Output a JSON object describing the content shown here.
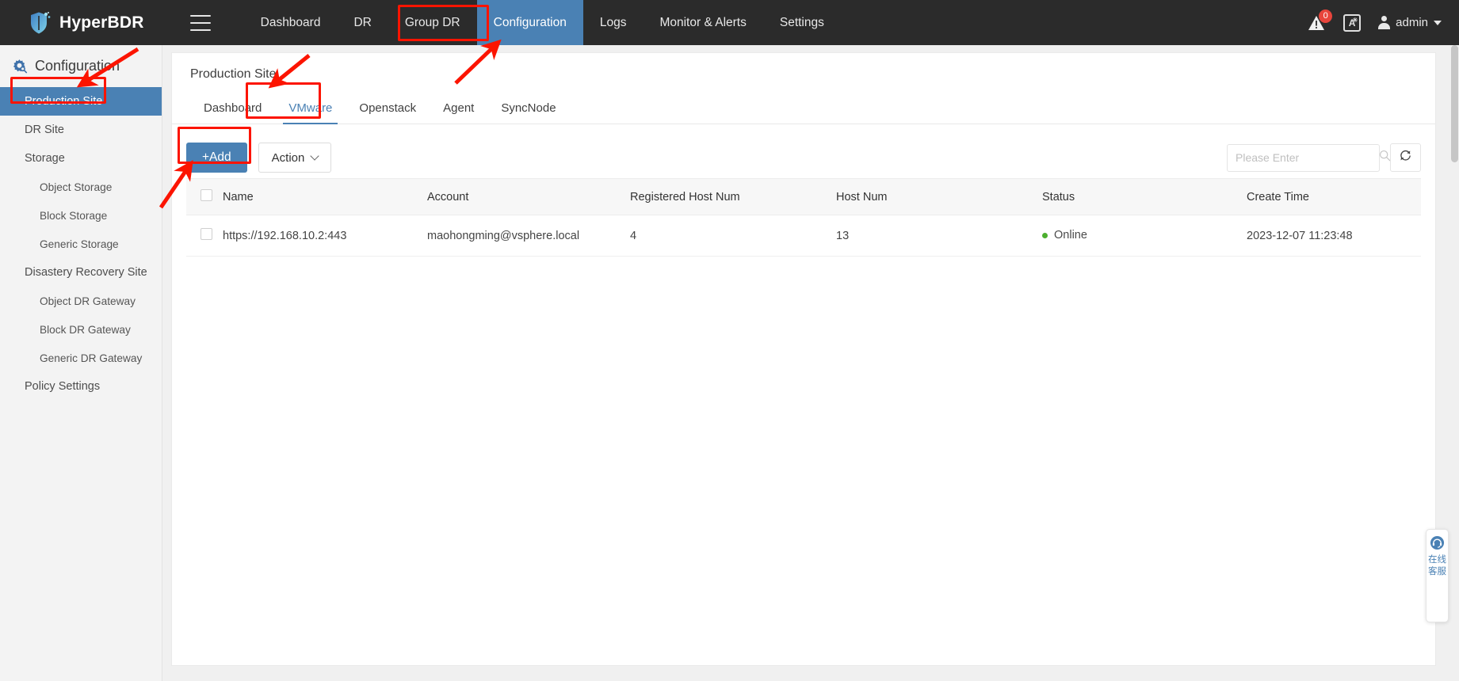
{
  "header": {
    "brand": "HyperBDR",
    "logo_icon": "shield-icon",
    "menu_icon": "hamburger-icon",
    "nav": [
      {
        "label": "Dashboard",
        "active": false
      },
      {
        "label": "DR",
        "active": false
      },
      {
        "label": "Group DR",
        "active": false
      },
      {
        "label": "Configuration",
        "active": true
      },
      {
        "label": "Logs",
        "active": false
      },
      {
        "label": "Monitor & Alerts",
        "active": false
      },
      {
        "label": "Settings",
        "active": false
      }
    ],
    "alert_icon": "warning-triangle-icon",
    "alert_count": "0",
    "language_icon": "translate-icon",
    "language_label": "A",
    "user_icon": "user-avatar-icon",
    "user_name": "admin",
    "user_caret_icon": "chevron-down-icon"
  },
  "sidebar": {
    "title": "Configuration",
    "title_icon": "gear-icon",
    "items": [
      {
        "label": "Production Site",
        "level": 1,
        "active": true
      },
      {
        "label": "DR Site",
        "level": 1,
        "active": false
      },
      {
        "label": "Storage",
        "level": 1,
        "active": false
      },
      {
        "label": "Object Storage",
        "level": 2,
        "active": false
      },
      {
        "label": "Block Storage",
        "level": 2,
        "active": false
      },
      {
        "label": "Generic Storage",
        "level": 2,
        "active": false
      },
      {
        "label": "Disastery Recovery Site",
        "level": 1,
        "active": false
      },
      {
        "label": "Object DR Gateway",
        "level": 2,
        "active": false
      },
      {
        "label": "Block DR Gateway",
        "level": 2,
        "active": false
      },
      {
        "label": "Generic DR Gateway",
        "level": 2,
        "active": false
      },
      {
        "label": "Policy Settings",
        "level": 1,
        "active": false
      }
    ]
  },
  "main": {
    "breadcrumb": "Production Site",
    "tabs": [
      {
        "label": "Dashboard",
        "active": false
      },
      {
        "label": "VMware",
        "active": true
      },
      {
        "label": "Openstack",
        "active": false
      },
      {
        "label": "Agent",
        "active": false
      },
      {
        "label": "SyncNode",
        "active": false
      }
    ],
    "toolbar": {
      "add_label": "+Add",
      "action_label": "Action",
      "action_caret_icon": "chevron-down-icon",
      "search_placeholder": "Please Enter",
      "search_value": "",
      "search_icon": "search-icon",
      "refresh_icon": "refresh-icon"
    },
    "table": {
      "columns": [
        "Name",
        "Account",
        "Registered Host Num",
        "Host Num",
        "Status",
        "Create Time"
      ],
      "rows": [
        {
          "selected": false,
          "name": "https://192.168.10.2:443",
          "account": "maohongming@vsphere.local",
          "registered_host_num": "4",
          "host_num": "13",
          "status": "Online",
          "status_color": "#4caf2f",
          "create_time": "2023-12-07 11:23:48"
        }
      ]
    }
  },
  "service_widget": {
    "icon": "headset-icon",
    "text": "在线客服"
  },
  "annotations": {
    "color": "#fc1400",
    "boxes": [
      {
        "name": "configuration-nav-highlight"
      },
      {
        "name": "production-site-sidebar-highlight"
      },
      {
        "name": "vmware-tab-highlight"
      },
      {
        "name": "add-button-highlight"
      }
    ],
    "arrows": [
      {
        "name": "arrow-to-production-site"
      },
      {
        "name": "arrow-to-vmware-tab"
      },
      {
        "name": "arrow-to-configuration-nav"
      },
      {
        "name": "arrow-to-add-button"
      }
    ]
  },
  "colors": {
    "accent": "#4a81b4",
    "header_bg": "#2b2b2b",
    "sidebar_bg": "#f3f3f3",
    "annotation_red": "#fc1400",
    "status_online": "#4caf2f"
  }
}
